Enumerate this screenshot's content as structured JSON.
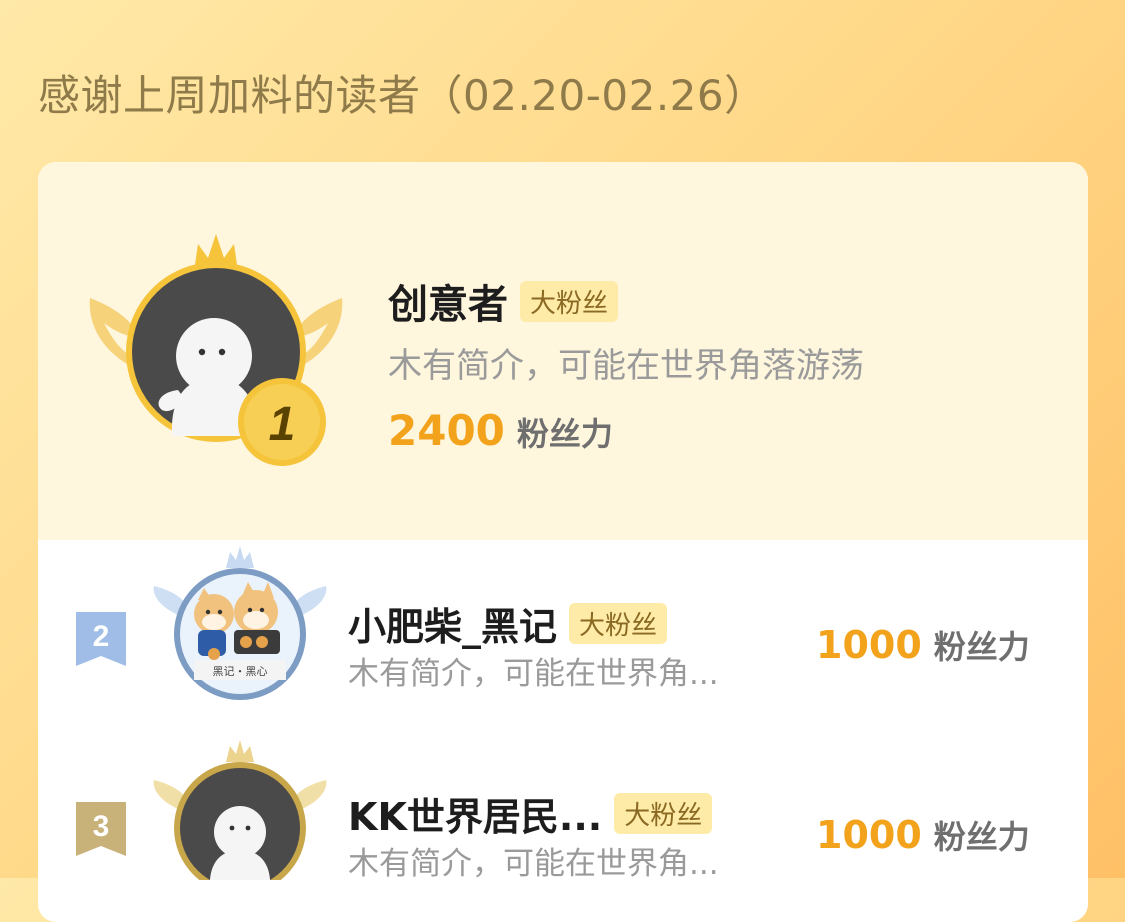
{
  "title": "感谢上周加料的读者（02.20-02.26）",
  "leaderboard": [
    {
      "rank": "1",
      "name": "创意者",
      "badge": "大粉丝",
      "bio": "木有简介，可能在世界角落游荡",
      "score": "2400",
      "unit": "粉丝力"
    },
    {
      "rank": "2",
      "name": "小肥柴_黑记",
      "badge": "大粉丝",
      "bio": "木有简介，可能在世界角...",
      "score": "1000",
      "unit": "粉丝力",
      "avatar_sign": "黑记・黑心"
    },
    {
      "rank": "3",
      "name": "KK世界居民...",
      "badge": "大粉丝",
      "bio": "木有简介，可能在世界角...",
      "score": "1000",
      "unit": "粉丝力"
    }
  ],
  "colors": {
    "gold": "#f2a21b",
    "silver_flag": "#9fbde6",
    "bronze_flag": "#c9b27a",
    "top_card_bg": "#fff6de"
  }
}
